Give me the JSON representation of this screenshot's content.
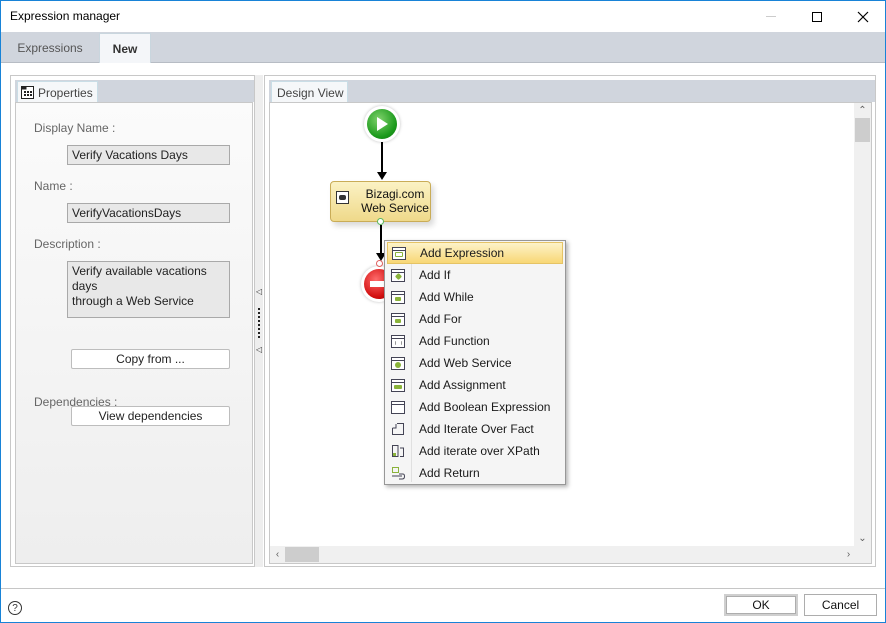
{
  "window": {
    "title": "Expression manager",
    "controls": {
      "minimize": "minimize",
      "maximize": "maximize",
      "close": "close"
    }
  },
  "tabs": [
    {
      "label": "Expressions",
      "active": false
    },
    {
      "label": "New",
      "active": true
    }
  ],
  "properties_panel": {
    "tab_label": "Properties",
    "tab_icon": "properties-grid-icon",
    "fields": {
      "display_name": {
        "label": "Display Name :",
        "value": "Verify Vacations Days"
      },
      "name": {
        "label": "Name :",
        "value": "VerifyVacationsDays"
      },
      "description": {
        "label": "Description :",
        "value_line1": "Verify available vacations days",
        "value_line2": "through a Web Service"
      }
    },
    "copy_from_button": "Copy from ...",
    "dependencies_label": "Dependencies :",
    "view_dependencies_button": "View dependencies"
  },
  "design_view": {
    "tab_label": "Design View",
    "nodes": {
      "start": {
        "type": "start-event",
        "color": "#1c9a1c"
      },
      "task": {
        "type": "web-service-task",
        "label_line1": "Bizagi.com",
        "label_line2": "Web Service",
        "fill": "#f4e3a3"
      },
      "end": {
        "type": "end-event",
        "color": "#d20f0f"
      }
    }
  },
  "context_menu": {
    "items": [
      {
        "label": "Add Expression",
        "icon": "expression-icon",
        "active": true
      },
      {
        "label": "Add If",
        "icon": "if-icon",
        "active": false
      },
      {
        "label": "Add While",
        "icon": "while-icon",
        "active": false
      },
      {
        "label": "Add For",
        "icon": "for-icon",
        "active": false
      },
      {
        "label": "Add Function",
        "icon": "function-icon",
        "active": false
      },
      {
        "label": "Add Web Service",
        "icon": "web-service-icon",
        "active": false
      },
      {
        "label": "Add Assignment",
        "icon": "assignment-icon",
        "active": false
      },
      {
        "label": "Add Boolean Expression",
        "icon": "boolean-expression-icon",
        "active": false
      },
      {
        "label": "Add Iterate Over Fact",
        "icon": "iterate-fact-icon",
        "active": false
      },
      {
        "label": "Add iterate over XPath",
        "icon": "iterate-xpath-icon",
        "active": false
      },
      {
        "label": "Add Return",
        "icon": "return-icon",
        "active": false
      }
    ]
  },
  "footer": {
    "help_glyph": "?",
    "ok_label": "OK",
    "cancel_label": "Cancel"
  }
}
